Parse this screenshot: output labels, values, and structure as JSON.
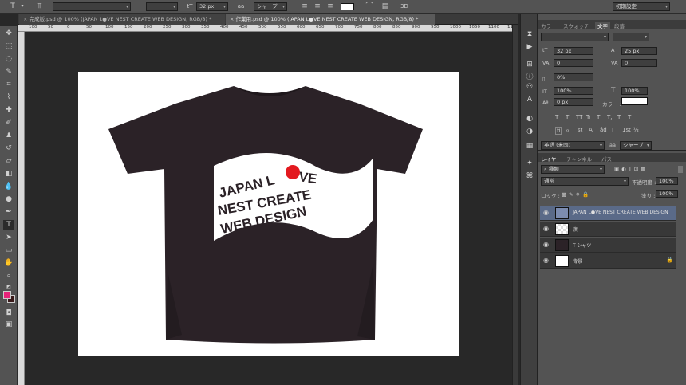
{
  "options_bar": {
    "font_size": "32 px",
    "antialias": "シャープ",
    "workspace": "初期設定"
  },
  "doc_tabs": [
    {
      "label": "完成版.psd @ 100% (JAPAN L●VE NEST CREATE WEB DESIGN, RGB/8) *"
    },
    {
      "label": "作業用.psd @ 100% (JAPAN L●VE NEST CREATE WEB DESIGN, RGB/8) *"
    }
  ],
  "ruler_labels": [
    "100",
    "50",
    "0",
    "50",
    "100",
    "150",
    "200",
    "250",
    "300",
    "350",
    "400",
    "450",
    "500",
    "550",
    "600",
    "650",
    "700",
    "750",
    "800",
    "850",
    "900",
    "950",
    "1000",
    "1050",
    "1100",
    "1150"
  ],
  "char_panel": {
    "tabs": [
      "カラー",
      "スウォッチ",
      "文字",
      "段落"
    ],
    "font_size": "32 px",
    "leading": "25 px",
    "kerning": "0",
    "tracking": "0",
    "tsume": "0%",
    "vscale": "100%",
    "hscale": "100%",
    "baseline": "0 px",
    "color_label": "カラー :",
    "language": "英語 (米国)",
    "antialias": "シャープ",
    "format_buttons": [
      "T",
      "T",
      "TT",
      "Tr",
      "T'",
      "T,",
      "T",
      "T"
    ],
    "ot_buttons": [
      "fi",
      "ℴ",
      "st",
      "A",
      "ād",
      "T",
      "1st",
      "½"
    ]
  },
  "layers_panel": {
    "tabs": [
      "レイヤー",
      "チャンネル",
      "パス"
    ],
    "filter": "種類",
    "blend_mode": "通常",
    "opacity_label": "不透明度 :",
    "opacity": "100%",
    "lock_label": "ロック :",
    "fill_label": "塗り :",
    "fill": "100%",
    "layers": [
      {
        "name": "JAPAN L●VE NEST CREATE WEB DESIGN"
      },
      {
        "name": "旗"
      },
      {
        "name": "T-シャツ"
      },
      {
        "name": "背景"
      }
    ]
  },
  "artwork": {
    "flag_lines": [
      "JAPAN L",
      "VE",
      "NEST CREATE",
      "WEB DESIGN"
    ],
    "shirt_color": "#2b2227",
    "dot_color": "#e3191f"
  },
  "colors": {
    "foreground": "#e8247a",
    "background": "#3a1a1a"
  }
}
